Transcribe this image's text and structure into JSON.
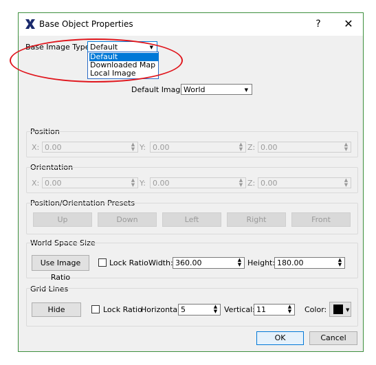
{
  "window": {
    "title": "Base Object Properties",
    "help": "?",
    "close": "✕"
  },
  "base_image_type": {
    "label": "Base Image Type:",
    "value": "Default",
    "options": [
      "Default",
      "Downloaded Map",
      "Local Image"
    ]
  },
  "default_image": {
    "label": "Default Image:",
    "value": "World"
  },
  "position": {
    "title": "Position",
    "x_label": "X:",
    "x": "0.00",
    "y_label": "Y:",
    "y": "0.00",
    "z_label": "Z:",
    "z": "0.00"
  },
  "orientation": {
    "title": "Orientation",
    "x_label": "X:",
    "x": "0.00",
    "y_label": "Y:",
    "y": "0.00",
    "z_label": "Z:",
    "z": "0.00"
  },
  "presets": {
    "title": "Position/Orientation Presets",
    "buttons": [
      "Up",
      "Down",
      "Left",
      "Right",
      "Front"
    ]
  },
  "world_size": {
    "title": "World Space Size",
    "use_image_ratio": "Use Image Ratio",
    "lock_ratio": "Lock Ratio",
    "width_label": "Width:",
    "width": "360.00",
    "height_label": "Height:",
    "height": "180.00"
  },
  "grid_lines": {
    "title": "Grid Lines",
    "hide": "Hide",
    "lock_ratio": "Lock Ratio",
    "horizontal_label": "Horizontal:",
    "horizontal": "5",
    "vertical_label": "Vertical:",
    "vertical": "11",
    "color_label": "Color:",
    "color": "#000000"
  },
  "footer": {
    "ok": "OK",
    "cancel": "Cancel"
  },
  "annotation_color": "#e0161d",
  "accent": "#0078d7"
}
